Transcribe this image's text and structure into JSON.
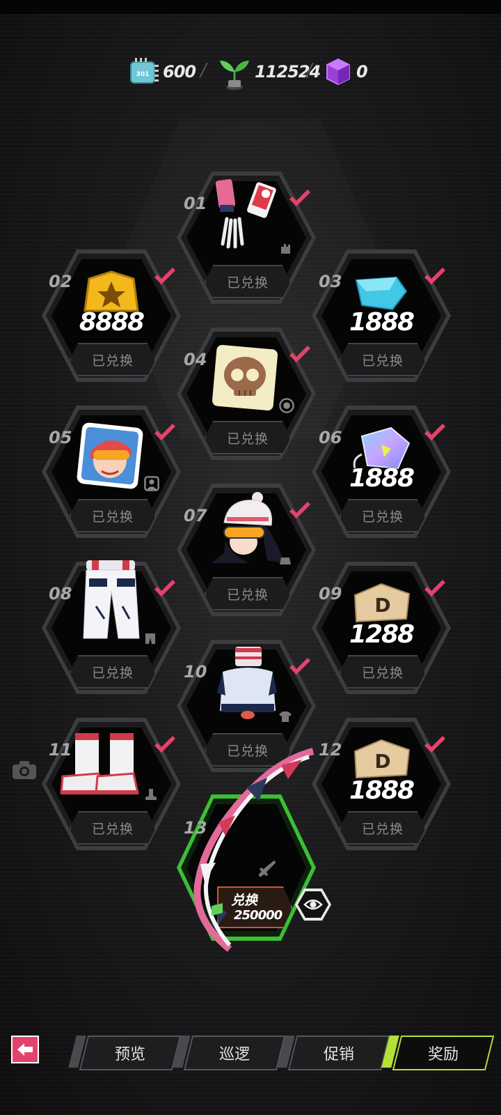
{
  "currencies": [
    {
      "name": "chip-currency",
      "value": "600",
      "icon_text": "301"
    },
    {
      "name": "sprout-currency",
      "value": "112524"
    },
    {
      "name": "cube-currency",
      "value": "0"
    }
  ],
  "slots": [
    {
      "num": "01",
      "status": "已兑换",
      "item": "gloves",
      "amount": ""
    },
    {
      "num": "02",
      "status": "已兑换",
      "item": "gold-badge",
      "amount": "8888"
    },
    {
      "num": "03",
      "status": "已兑换",
      "item": "blue-crystal",
      "amount": "1888"
    },
    {
      "num": "04",
      "status": "已兑换",
      "item": "skull-emote",
      "amount": ""
    },
    {
      "num": "05",
      "status": "已兑换",
      "item": "avatar-portrait",
      "amount": ""
    },
    {
      "num": "06",
      "status": "已兑换",
      "item": "holo-tag",
      "amount": "1888"
    },
    {
      "num": "07",
      "status": "已兑换",
      "item": "beanie-goggles",
      "amount": ""
    },
    {
      "num": "08",
      "status": "已兑换",
      "item": "pants",
      "amount": ""
    },
    {
      "num": "09",
      "status": "已兑换",
      "item": "d-ticket",
      "amount": "1288"
    },
    {
      "num": "10",
      "status": "已兑换",
      "item": "top",
      "amount": ""
    },
    {
      "num": "11",
      "status": "已兑换",
      "item": "boots",
      "amount": ""
    },
    {
      "num": "12",
      "status": "已兑换",
      "item": "d-ticket",
      "amount": "1888"
    }
  ],
  "final_slot": {
    "num": "13",
    "action": "兑换",
    "cost": "250000",
    "item": "sword"
  },
  "nav": {
    "tabs": [
      "预览",
      "巡逻",
      "促销",
      "奖励"
    ],
    "active": "奖励"
  },
  "colors": {
    "accent_green": "#b4e03a",
    "check_red": "#e3436b",
    "exchange_orange": "#d8542c"
  }
}
